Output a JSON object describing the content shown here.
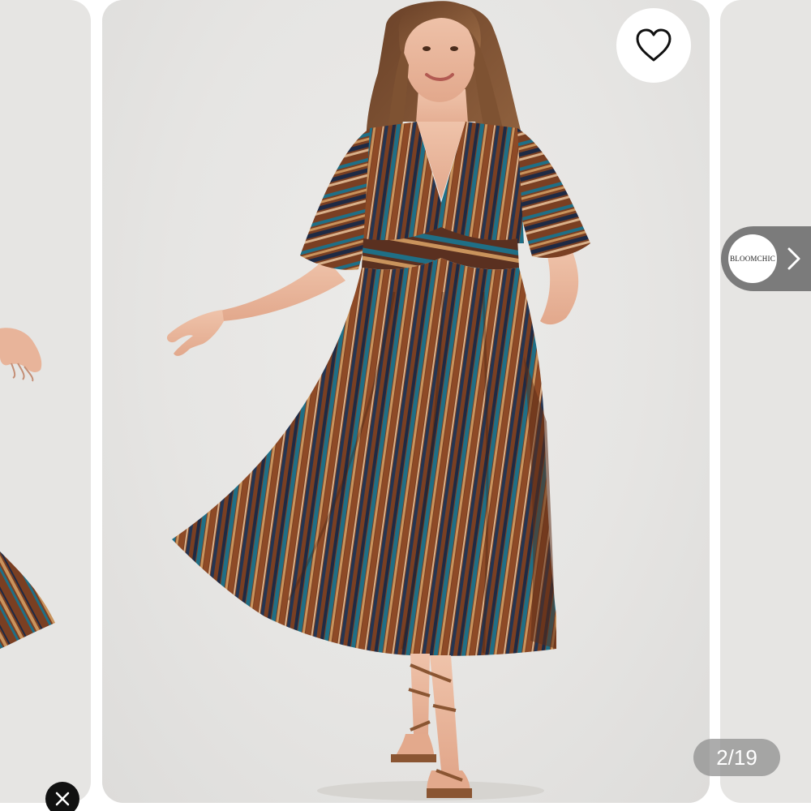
{
  "gallery": {
    "counter": "2/19",
    "brand": {
      "logo_text": "BLOOMCHIC"
    },
    "icons": {
      "favorite": "heart-icon",
      "next": "chevron-right-icon",
      "close": "close-icon"
    },
    "colors": {
      "card_background": "#e6e5e3",
      "brand_pill": "#7b7b7b",
      "counter_pill": "#8c8c8c",
      "close_button": "#111111",
      "dress_brown": "#7a3f22",
      "dress_teal": "#1f6f86",
      "dress_navy": "#1e2a44",
      "dress_tan": "#c9935c"
    }
  }
}
